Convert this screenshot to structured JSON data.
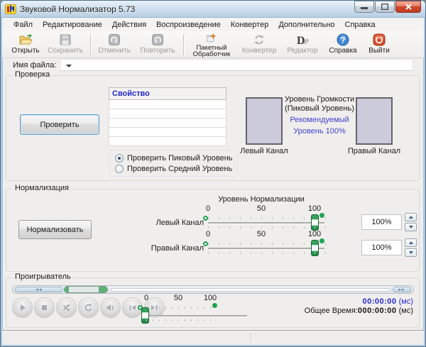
{
  "window": {
    "title": "Звуковой Нормализатор 5.73"
  },
  "menu": {
    "items": [
      "Файл",
      "Редактирование",
      "Действия",
      "Воспроизведение",
      "Конвертер",
      "Дополнительно",
      "Справка"
    ]
  },
  "toolbar": {
    "buttons": [
      {
        "label": "Открыть",
        "icon": "open-folder-icon",
        "enabled": true
      },
      {
        "label": "Сохранить",
        "icon": "save-icon",
        "enabled": false
      },
      {
        "label": "Отменить",
        "icon": "undo-icon",
        "enabled": false
      },
      {
        "label": "Повторить",
        "icon": "redo-icon",
        "enabled": false
      },
      {
        "label": "Пакетный Обработчик",
        "icon": "batch-processor-icon",
        "enabled": true
      },
      {
        "label": "Конвертер",
        "icon": "converter-icon",
        "enabled": false
      },
      {
        "label": "Редактор",
        "icon": "editor-icon",
        "enabled": false
      },
      {
        "label": "Справка",
        "icon": "help-icon",
        "enabled": true
      },
      {
        "label": "Выйти",
        "icon": "exit-icon",
        "enabled": true
      }
    ]
  },
  "file_row": {
    "label": "Имя файла:",
    "value": ""
  },
  "check": {
    "legend": "Проверка",
    "check_button": "Проверить",
    "table": {
      "header": "Свойство",
      "rows": [
        "",
        "",
        "",
        "",
        ""
      ]
    },
    "radios": [
      {
        "label": "Проверить Пиковый Уровень",
        "selected": true
      },
      {
        "label": "Проверить Средний Уровень",
        "selected": false
      }
    ],
    "volume_title_line1": "Уровень Громкости",
    "volume_title_line2": "(Пиковый Уровень)",
    "recommended_line1": "Рекомендуемый",
    "recommended_line2": "Уровень 100%",
    "left_channel_label": "Левый Канал",
    "right_channel_label": "Правый Канал"
  },
  "normalization": {
    "legend": "Нормализация",
    "normalize_button": "Нормализовать",
    "level_title": "Уровень Нормализации",
    "scale": [
      "0",
      "50",
      "100"
    ],
    "left": {
      "label": "Левый Канал",
      "value": "100%",
      "slider_percent": 100
    },
    "right": {
      "label": "Правый Канал",
      "value": "100%",
      "slider_percent": 100
    }
  },
  "player": {
    "legend": "Проигрыватель",
    "seek_back_glyph": "◂◂",
    "seek_forward_glyph": "▸▸",
    "buttons": [
      "play",
      "stop",
      "shuffle",
      "repeat",
      "volume",
      "previous",
      "next"
    ],
    "scale": [
      "0",
      "50",
      "100"
    ],
    "volume_slider_percent": 0,
    "current_time": "00:00:00",
    "current_time_suffix": " (мс)",
    "total_time_label": "Общее Время:",
    "total_time": "000:00:00",
    "total_time_suffix": " (мс)"
  },
  "statusbar": {
    "left_cell": "",
    "right_cell": ""
  },
  "colors": {
    "titlebar_blue": "#cfdfee",
    "accent_focus_blue": "#5e9bc8",
    "link_blue": "#2525c8",
    "recommended_blue": "#4242cf",
    "slider_green": "#1fa352",
    "exit_red": "#d94f2b",
    "level_bar_fill": "#cbcbdb",
    "dialog_bg": "#f0eeec"
  }
}
